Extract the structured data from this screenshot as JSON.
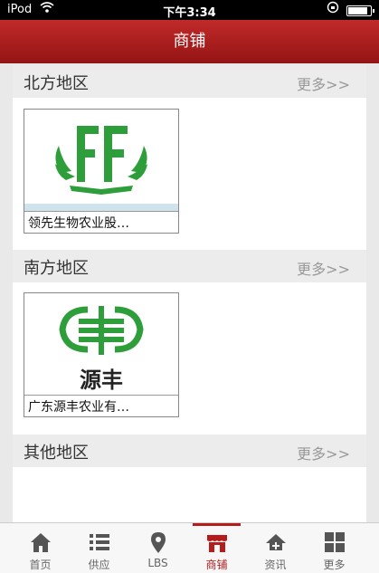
{
  "status_bar": {
    "carrier": "iPod",
    "time": "下午3:34"
  },
  "header": {
    "title": "商铺"
  },
  "sections": [
    {
      "title": "北方地区",
      "more": "更多>>",
      "items": [
        {
          "name": "领先生物农业股…",
          "logo": "leaf-ff-logo"
        }
      ]
    },
    {
      "title": "南方地区",
      "more": "更多>>",
      "items": [
        {
          "name": "广东源丰农业有…",
          "logo": "yuanfeng-logo",
          "logo_text": "源丰"
        }
      ]
    },
    {
      "title": "其他地区",
      "more": "更多>>",
      "items": []
    }
  ],
  "tabs": [
    {
      "label": "首页",
      "icon": "home-icon"
    },
    {
      "label": "供应",
      "icon": "list-icon"
    },
    {
      "label": "LBS",
      "icon": "location-pin-icon"
    },
    {
      "label": "商铺",
      "icon": "shop-icon",
      "active": true
    },
    {
      "label": "资讯",
      "icon": "news-icon"
    },
    {
      "label": "更多",
      "icon": "grid-icon"
    }
  ],
  "colors": {
    "accent": "#b51d1d",
    "logo_green": "#2e9e3a"
  }
}
